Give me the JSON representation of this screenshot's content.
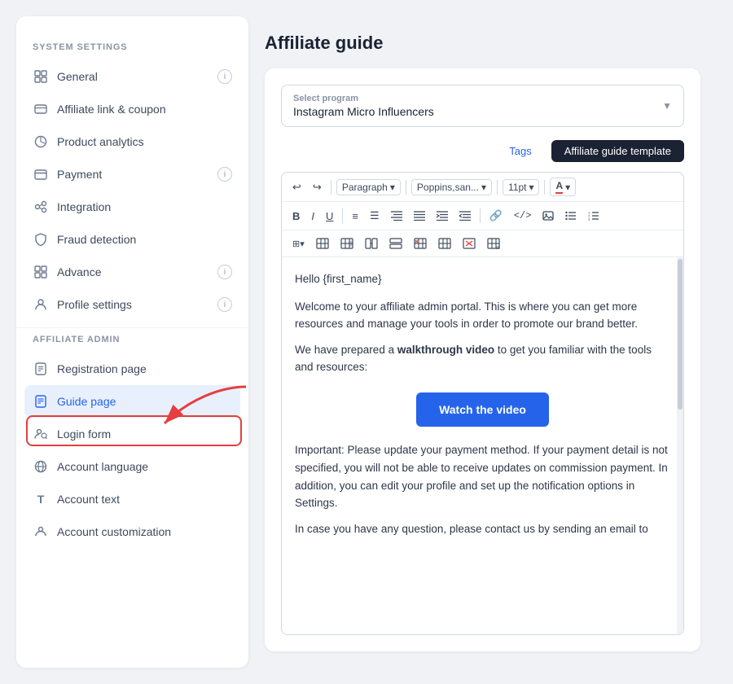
{
  "sidebar": {
    "system_settings_title": "SYSTEM SETTINGS",
    "affiliate_admin_title": "AFFILIATE ADMIN",
    "system_items": [
      {
        "id": "general",
        "label": "General",
        "icon": "⊟",
        "badge": true
      },
      {
        "id": "affiliate-link",
        "label": "Affiliate link & coupon",
        "icon": "🔗",
        "badge": false
      },
      {
        "id": "product-analytics",
        "label": "Product analytics",
        "icon": "📊",
        "badge": false
      },
      {
        "id": "payment",
        "label": "Payment",
        "icon": "💳",
        "badge": true
      },
      {
        "id": "integration",
        "label": "Integration",
        "icon": "⚙",
        "badge": false
      },
      {
        "id": "fraud-detection",
        "label": "Fraud detection",
        "icon": "🛡",
        "badge": false
      },
      {
        "id": "advance",
        "label": "Advance",
        "icon": "⊞",
        "badge": true
      },
      {
        "id": "profile-settings",
        "label": "Profile settings",
        "icon": "👤",
        "badge": true
      }
    ],
    "affiliate_items": [
      {
        "id": "registration-page",
        "label": "Registration page",
        "icon": "📋",
        "badge": false
      },
      {
        "id": "guide-page",
        "label": "Guide page",
        "icon": "📄",
        "badge": false,
        "active": true
      },
      {
        "id": "login-form",
        "label": "Login form",
        "icon": "👥",
        "badge": false
      },
      {
        "id": "account-language",
        "label": "Account language",
        "icon": "🌐",
        "badge": false
      },
      {
        "id": "account-text",
        "label": "Account text",
        "icon": "T",
        "badge": false
      },
      {
        "id": "account-customization",
        "label": "Account customization",
        "icon": "👤",
        "badge": false
      }
    ]
  },
  "main": {
    "page_title": "Affiliate guide",
    "select_program": {
      "label": "Select program",
      "value": "Instagram Micro Influencers"
    },
    "tabs": [
      {
        "id": "tags",
        "label": "Tags",
        "active": false
      },
      {
        "id": "affiliate-guide-template",
        "label": "Affiliate guide template",
        "active": true
      }
    ],
    "toolbar": {
      "format_paragraph": "Paragraph",
      "font_name": "Poppins,san...",
      "font_size": "11pt",
      "font_color_label": "A"
    },
    "editor": {
      "hello_line": "Hello {first_name}",
      "para1": "Welcome to your affiliate admin portal. This is where you can get more resources and manage your tools in order to promote our brand better.",
      "para2_prefix": "We have prepared a ",
      "para2_bold": "walkthrough video",
      "para2_suffix": " to get you familiar with the tools and resources:",
      "watch_btn_label": "Watch the video",
      "para3": "Important: Please update your payment method. If your payment detail is not specified, you will not be able to receive updates on commission payment. In addition, you can edit your profile and set up the notification options in Settings.",
      "para4": "In case you have any question, please contact us by sending an email to"
    }
  }
}
